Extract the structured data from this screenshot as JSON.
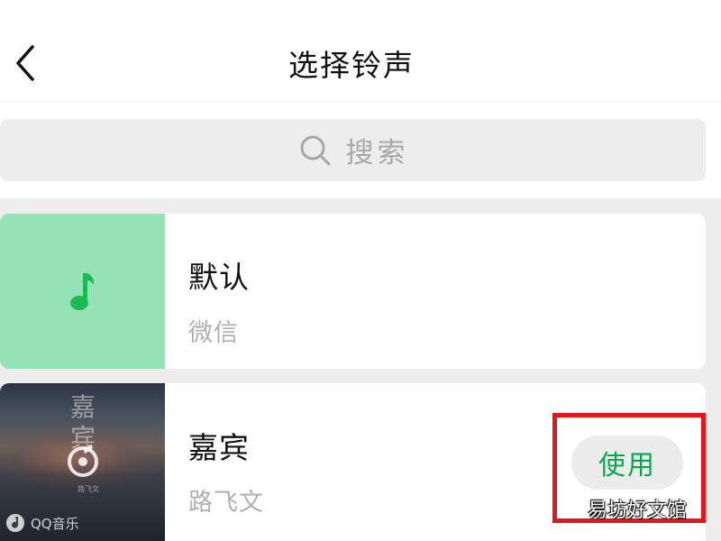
{
  "header": {
    "back_icon": "chevron-left-icon",
    "title": "选择铃声"
  },
  "search": {
    "icon": "search-icon",
    "placeholder": "搜索"
  },
  "ringtones": [
    {
      "title": "默认",
      "subtitle": "微信",
      "cover_color": "#95e2b6",
      "cover_icon": "music-note-icon",
      "icon_color": "#1db954"
    },
    {
      "title": "嘉宾",
      "subtitle": "路飞文",
      "cover_text": "嘉宾",
      "cover_small_text": "路飞文",
      "cover_badge": "QQ音乐",
      "cover_icon": "qq-music-icon",
      "action_label": "使用"
    }
  ],
  "accent_color": "#07a651",
  "highlight_color": "#e5151a",
  "watermark": "易坊好文馆"
}
